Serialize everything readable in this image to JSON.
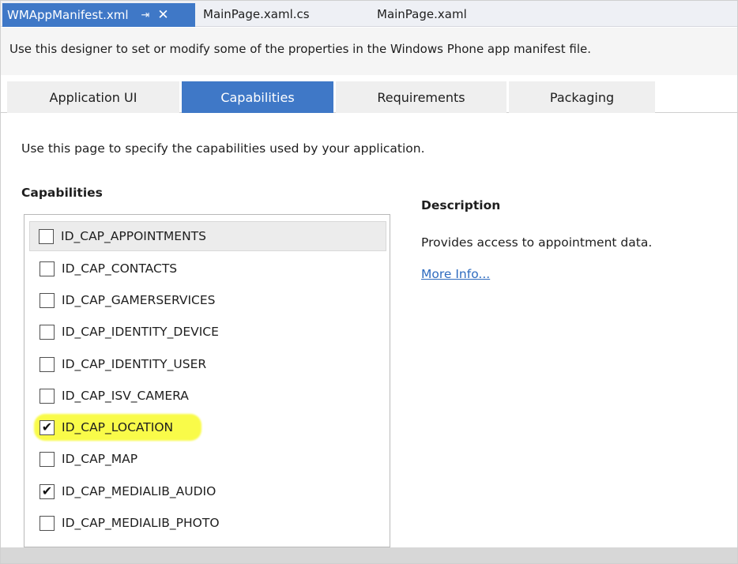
{
  "document_tabs": [
    {
      "label": "WMAppManifest.xml",
      "active": true
    },
    {
      "label": "MainPage.xaml.cs",
      "active": false
    },
    {
      "label": "MainPage.xaml",
      "active": false
    }
  ],
  "document_tab_icons": {
    "pin": "pin-icon",
    "close": "close-icon"
  },
  "header": {
    "description": "Use this designer to set or modify some of the properties in the Windows Phone app manifest file."
  },
  "designer_tabs": [
    {
      "label": "Application UI",
      "active": false
    },
    {
      "label": "Capabilities",
      "active": true
    },
    {
      "label": "Requirements",
      "active": false
    },
    {
      "label": "Packaging",
      "active": false
    }
  ],
  "page": {
    "intro": "Use this page to specify the capabilities used by your application.",
    "capabilities_heading": "Capabilities"
  },
  "capabilities": [
    {
      "label": "ID_CAP_APPOINTMENTS",
      "checked": false,
      "selected": true
    },
    {
      "label": "ID_CAP_CONTACTS",
      "checked": false
    },
    {
      "label": "ID_CAP_GAMERSERVICES",
      "checked": false
    },
    {
      "label": "ID_CAP_IDENTITY_DEVICE",
      "checked": false
    },
    {
      "label": "ID_CAP_IDENTITY_USER",
      "checked": false
    },
    {
      "label": "ID_CAP_ISV_CAMERA",
      "checked": false
    },
    {
      "label": "ID_CAP_LOCATION",
      "checked": true,
      "highlighted": true
    },
    {
      "label": "ID_CAP_MAP",
      "checked": false
    },
    {
      "label": "ID_CAP_MEDIALIB_AUDIO",
      "checked": true
    },
    {
      "label": "ID_CAP_MEDIALIB_PHOTO",
      "checked": false
    }
  ],
  "description_panel": {
    "heading": "Description",
    "text": "Provides access to appointment data.",
    "link": "More Info..."
  },
  "colors": {
    "accent": "#3f78c7",
    "highlight": "#f9fb49",
    "link": "#2e6bbf"
  }
}
